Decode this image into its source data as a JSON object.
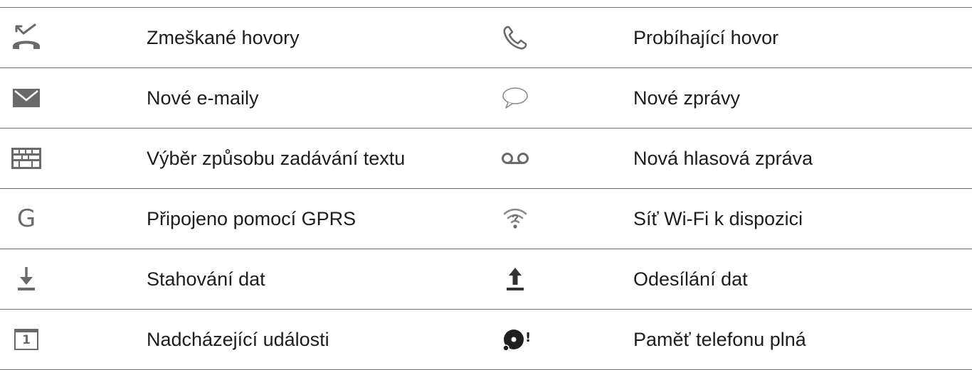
{
  "rows": [
    {
      "left": {
        "icon": "missed-call-icon",
        "label": "Zmeškané hovory"
      },
      "right": {
        "icon": "ongoing-call-icon",
        "label": "Probíhající hovor"
      }
    },
    {
      "left": {
        "icon": "email-icon",
        "label": "Nové e-maily"
      },
      "right": {
        "icon": "message-bubble-icon",
        "label": "Nové zprávy"
      }
    },
    {
      "left": {
        "icon": "keyboard-icon",
        "label": "Výběr způsobu zadávání textu"
      },
      "right": {
        "icon": "voicemail-icon",
        "label": "Nová hlasová zpráva"
      }
    },
    {
      "left": {
        "icon": "gprs-icon",
        "glyph": "G",
        "label": "Připojeno pomocí GPRS"
      },
      "right": {
        "icon": "wifi-available-icon",
        "label": "Síť Wi-Fi k dispozici"
      }
    },
    {
      "left": {
        "icon": "download-icon",
        "label": "Stahování dat"
      },
      "right": {
        "icon": "upload-icon",
        "label": "Odesílání dat"
      }
    },
    {
      "left": {
        "icon": "calendar-icon",
        "glyph": "1",
        "label": "Nadcházející události"
      },
      "right": {
        "icon": "storage-full-icon",
        "glyph": "!",
        "label": "Paměť telefonu plná"
      }
    }
  ],
  "colors": {
    "icon_gray": "#6a6a6a",
    "divider": "#6f6f6f",
    "text": "#1d1d1d"
  }
}
